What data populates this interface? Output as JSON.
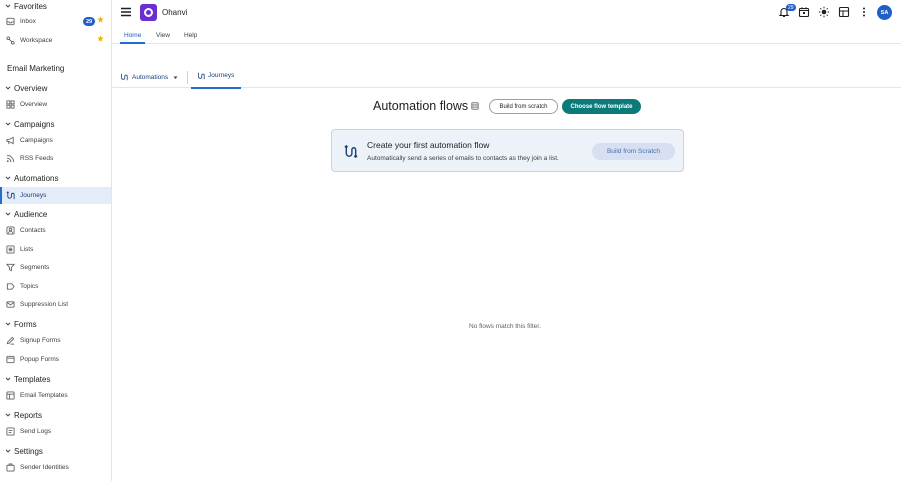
{
  "app": {
    "name": "Ohanvi",
    "logo_color": "#6a2ed1",
    "accent": "#1f6fd1",
    "primary_button_color": "#0b7a78"
  },
  "sidebar": {
    "favorites": {
      "title": "Favorites",
      "items": [
        {
          "label": "Inbox",
          "icon": "inbox-icon",
          "badge": "29",
          "starred": true
        },
        {
          "label": "Workspace",
          "icon": "workspace-icon",
          "starred": true
        }
      ]
    },
    "group_title": "Email Marketing",
    "sections": {
      "overview": {
        "title": "Overview",
        "items": [
          {
            "label": "Overview",
            "icon": "grid-icon"
          }
        ]
      },
      "campaigns": {
        "title": "Campaigns",
        "items": [
          {
            "label": "Campaigns",
            "icon": "megaphone-icon"
          },
          {
            "label": "RSS Feeds",
            "icon": "rss-icon"
          }
        ]
      },
      "automations": {
        "title": "Automations",
        "items": [
          {
            "label": "Journeys",
            "icon": "flow-icon",
            "active": true
          }
        ]
      },
      "audience": {
        "title": "Audience",
        "items": [
          {
            "label": "Contacts",
            "icon": "contact-icon"
          },
          {
            "label": "Lists",
            "icon": "list-icon"
          },
          {
            "label": "Segments",
            "icon": "filter-icon"
          },
          {
            "label": "Topics",
            "icon": "tag-icon"
          },
          {
            "label": "Suppression List",
            "icon": "mail-block-icon"
          }
        ]
      },
      "forms": {
        "title": "Forms",
        "items": [
          {
            "label": "Signup Forms",
            "icon": "signup-icon"
          },
          {
            "label": "Popup Forms",
            "icon": "popup-icon"
          }
        ]
      },
      "templates": {
        "title": "Templates",
        "items": [
          {
            "label": "Email Templates",
            "icon": "template-icon"
          }
        ]
      },
      "reports": {
        "title": "Reports",
        "items": [
          {
            "label": "Send Logs",
            "icon": "log-icon"
          }
        ]
      },
      "settings": {
        "title": "Settings",
        "items": [
          {
            "label": "Sender Identities",
            "icon": "identity-icon"
          }
        ]
      }
    }
  },
  "topbar": {
    "notification_count": "29",
    "avatar_initials": "SA"
  },
  "ribbon": {
    "tabs": [
      {
        "label": "Home",
        "active": true
      },
      {
        "label": "View"
      },
      {
        "label": "Help"
      }
    ]
  },
  "content_bar": {
    "dropdown_label": "Automations",
    "tab_label": "Journeys"
  },
  "main": {
    "title": "Automation flows",
    "build_from_scratch_label": "Build from scratch",
    "choose_template_label": "Choose flow template",
    "promo": {
      "title": "Create your first automation flow",
      "description": "Automatically send a series of emails to contacts as they join a list.",
      "button_label": "Build from Scratch"
    },
    "empty_message": "No flows match this filter."
  }
}
